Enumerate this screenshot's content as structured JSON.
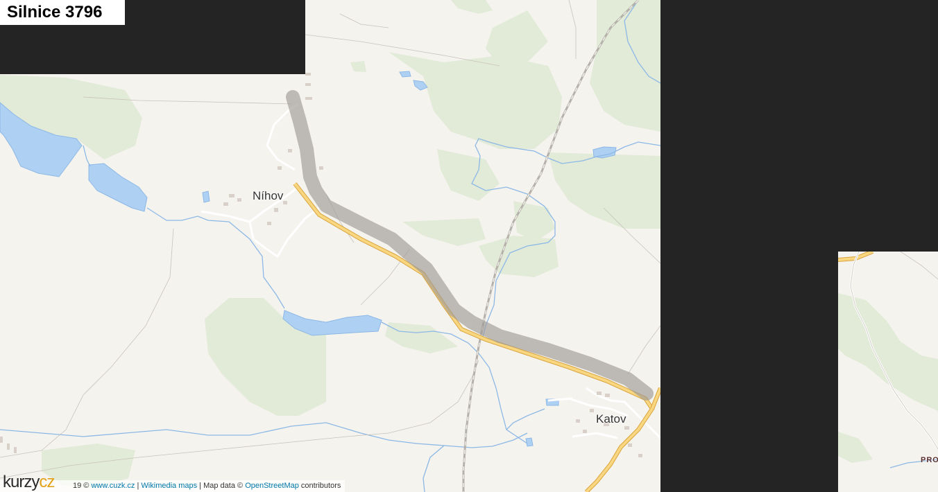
{
  "title": "Silnice 3796",
  "places": {
    "nihov": "Níhov",
    "katov": "Katov",
    "right_tile_label": "PRO"
  },
  "attribution": {
    "prefix": "19 ©",
    "link1": "www.cuzk.cz",
    "sep1": "|",
    "link2": "Wikimedia maps",
    "sep2": "| Map data ©",
    "link3": "OpenStreetMap",
    "suffix": "contributors"
  },
  "logo": {
    "part1": "kurzy",
    "part2": "cz"
  },
  "colors": {
    "land": "#f5f3ee",
    "forest": "#e2ead8",
    "water": "#aed0f2",
    "stream": "#8cb8e6",
    "road_major": "#f9d680",
    "road_major_casing": "#d9a33c",
    "route_highlight": "#9e9a96",
    "background": "#242424"
  },
  "icons": {
    "map": "route-map",
    "logo": "kurzy-logo"
  }
}
